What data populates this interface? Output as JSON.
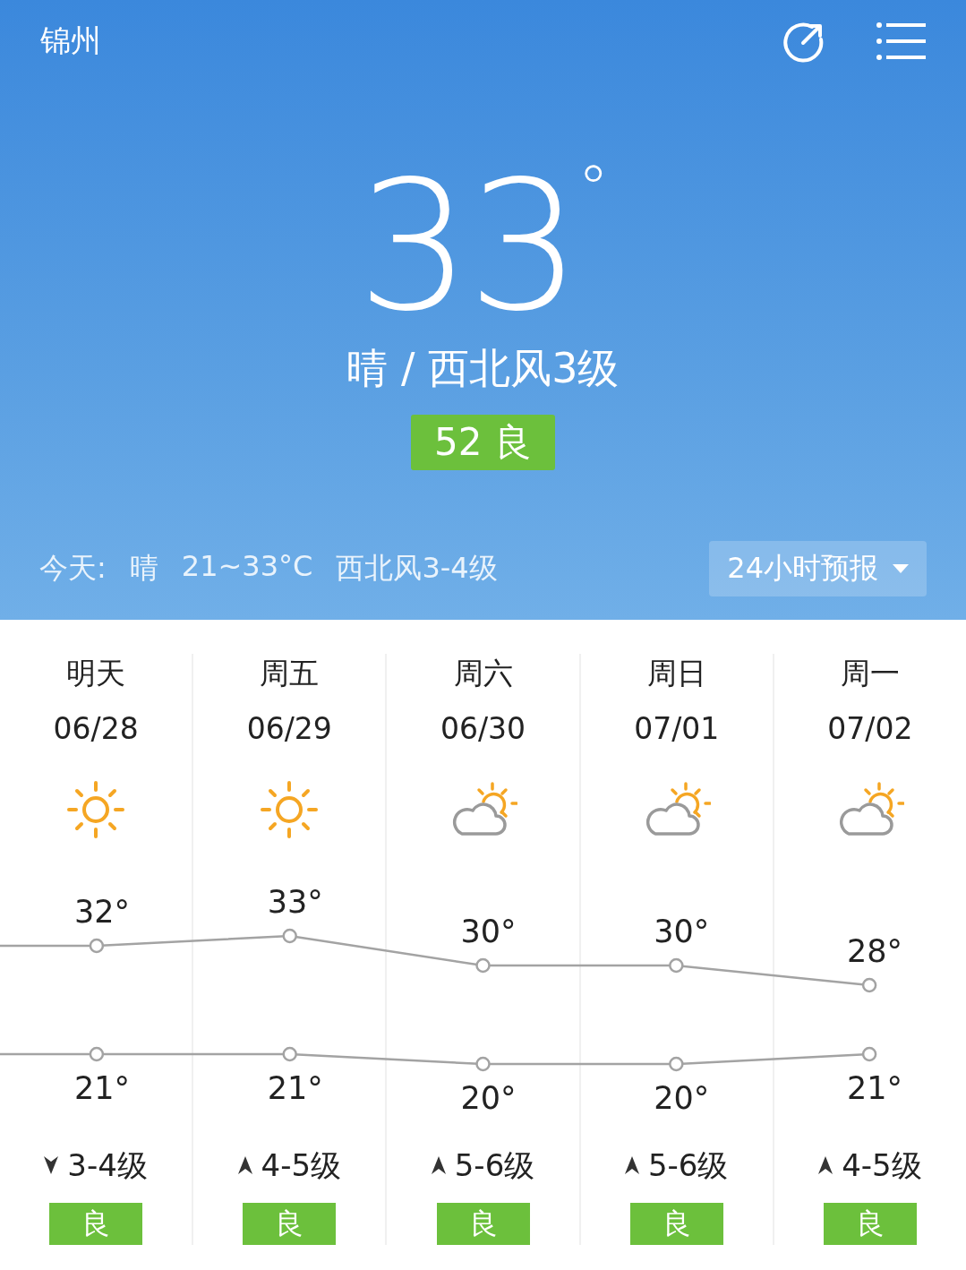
{
  "city": "锦州",
  "current": {
    "temperature": "33",
    "degree": "°",
    "condition": "晴 / 西北风3级",
    "aqi": "52 良"
  },
  "today": {
    "label": "今天:",
    "weather": "晴",
    "range": "21~33°C",
    "wind": "西北风3-4级"
  },
  "forecast_button": {
    "label": "24小时预报"
  },
  "days": [
    {
      "name": "明天",
      "date": "06/28",
      "cloudy": false,
      "wind_arrow_up": false,
      "wind": "3-4级",
      "aqi": "良"
    },
    {
      "name": "周五",
      "date": "06/29",
      "cloudy": false,
      "wind_arrow_up": true,
      "wind": "4-5级",
      "aqi": "良"
    },
    {
      "name": "周六",
      "date": "06/30",
      "cloudy": true,
      "wind_arrow_up": true,
      "wind": "5-6级",
      "aqi": "良"
    },
    {
      "name": "周日",
      "date": "07/01",
      "cloudy": true,
      "wind_arrow_up": true,
      "wind": "5-6级",
      "aqi": "良"
    },
    {
      "name": "周一",
      "date": "07/02",
      "cloudy": true,
      "wind_arrow_up": true,
      "wind": "4-5级",
      "aqi": "良"
    }
  ],
  "chart_data": {
    "type": "line",
    "categories": [
      null,
      null,
      null,
      null,
      null
    ],
    "data_labels": true,
    "series": [
      {
        "color": "#a3a3a3",
        "marker": "circle",
        "values": [
          32,
          33,
          30,
          30,
          28
        ],
        "value_labels": [
          "32°",
          "33°",
          "30°",
          "30°",
          "28°"
        ]
      },
      {
        "color": "#a3a3a3",
        "marker": "circle",
        "values": [
          21,
          21,
          20,
          20,
          21
        ],
        "value_labels": [
          "21°",
          "21°",
          "20°",
          "20°",
          "21°"
        ]
      }
    ]
  }
}
